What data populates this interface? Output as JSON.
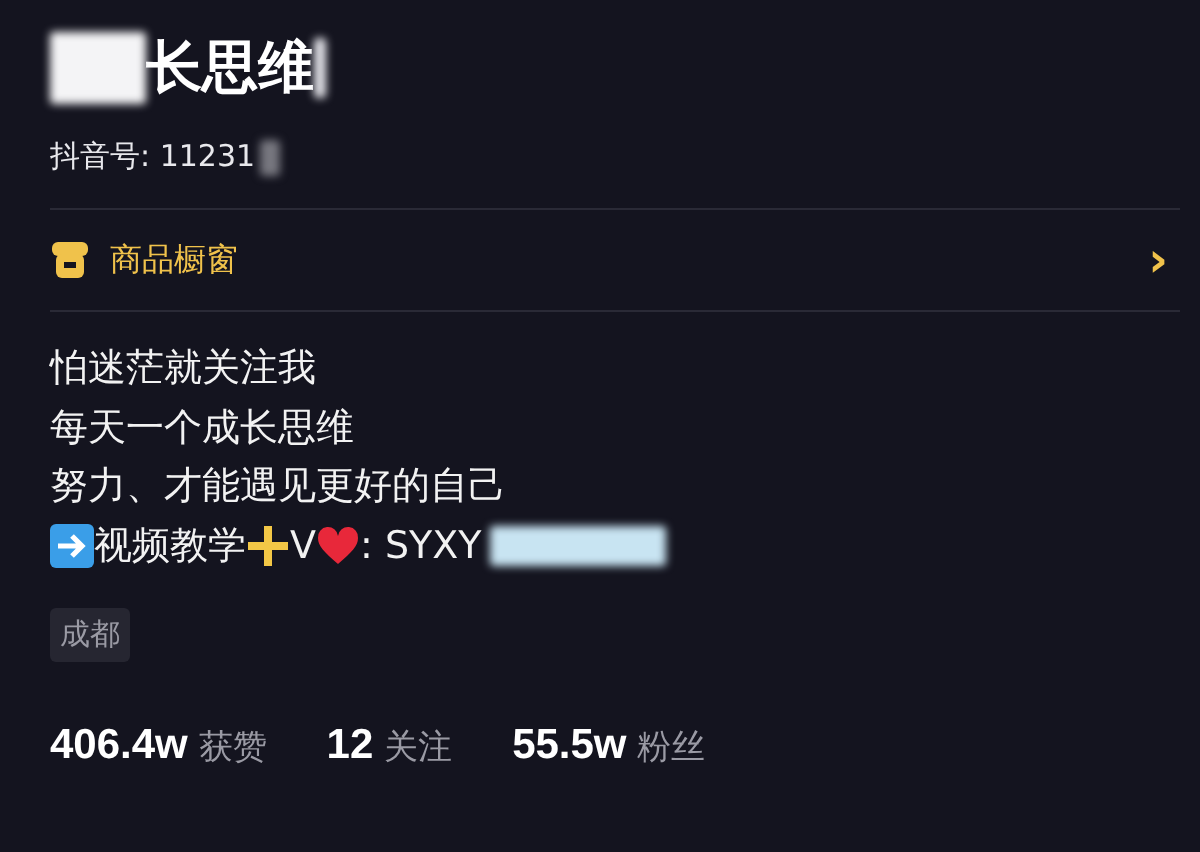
{
  "profile": {
    "name": "长思维",
    "id_label": "抖音号: 11231"
  },
  "shop_row": {
    "label": "商品橱窗",
    "chevron": "›"
  },
  "bio": [
    "怕迷茫就关注我",
    "每天一个成长思维",
    "努力、才能遇见更好的自己"
  ],
  "bio_contact": [
    {
      "kind": "arrow"
    },
    {
      "kind": "text",
      "text": "视频教学"
    },
    {
      "kind": "plus"
    },
    {
      "kind": "text",
      "text": "V"
    },
    {
      "kind": "heart"
    },
    {
      "kind": "text",
      "text": ": SYXY"
    }
  ],
  "location_tag": "成都",
  "stats": [
    "**406.4w** 获赞",
    "**12** 关注",
    "**55.5w** 粉丝"
  ]
}
